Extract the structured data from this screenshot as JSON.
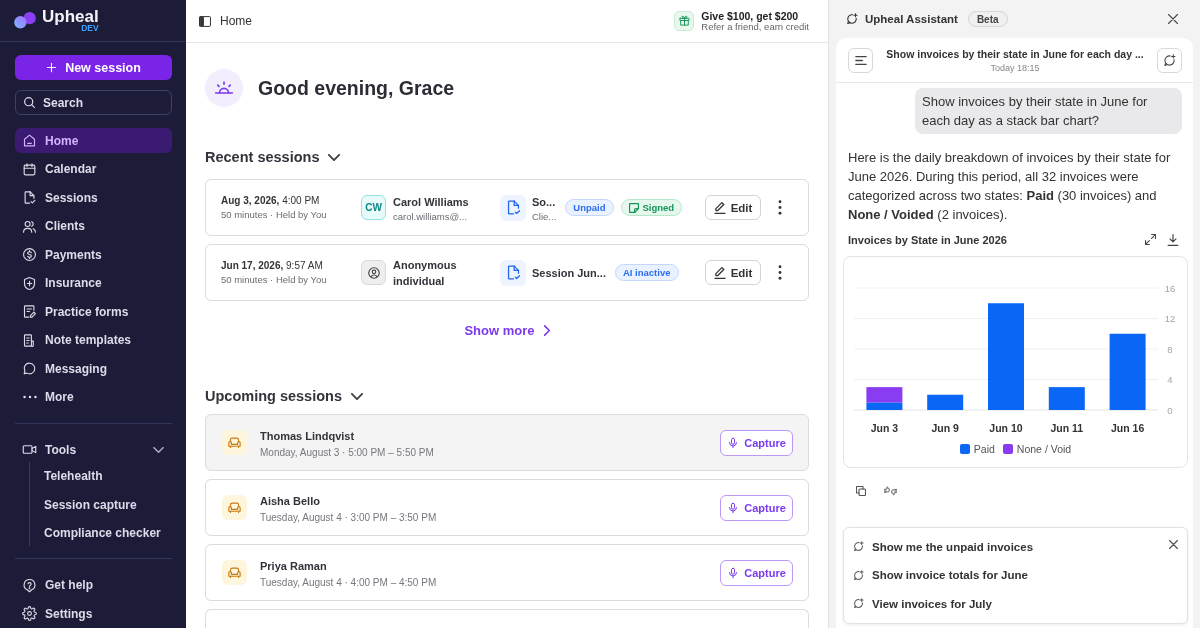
{
  "sidebar": {
    "brand": "Upheal",
    "brand_tag": "DEV",
    "new_session": "New session",
    "search": {
      "placeholder": "Search"
    },
    "nav": [
      {
        "label": "Home",
        "selected": true
      },
      {
        "label": "Calendar",
        "selected": false
      },
      {
        "label": "Sessions",
        "selected": false
      },
      {
        "label": "Clients",
        "selected": false
      },
      {
        "label": "Payments",
        "selected": false
      },
      {
        "label": "Insurance",
        "selected": false
      },
      {
        "label": "Practice forms",
        "selected": false
      },
      {
        "label": "Note templates",
        "selected": false
      },
      {
        "label": "Messaging",
        "selected": false
      },
      {
        "label": "More",
        "selected": false
      }
    ],
    "tools": {
      "label": "Tools",
      "expanded": true,
      "children": [
        {
          "label": "Telehealth"
        },
        {
          "label": "Session capture"
        },
        {
          "label": "Compliance checker"
        }
      ]
    },
    "footer": [
      {
        "label": "Get help"
      },
      {
        "label": "Settings"
      }
    ]
  },
  "header": {
    "breadcrumb": "Home",
    "promo": {
      "title": "Give $100, get $200",
      "subtitle": "Refer a friend, earn credit"
    }
  },
  "greeting": "Good evening, Grace",
  "recent_sessions": {
    "title": "Recent sessions",
    "expanded": true,
    "sessions": [
      {
        "when": "**Aug 3, 2026,** 4:00 PM",
        "details": "50 minutes · Held by You",
        "client": {
          "kind": "initials",
          "initials": "CW",
          "name": "Carol Williams",
          "email": "carol.williams@..."
        },
        "note": {
          "title": "So...",
          "subtitle": "Clie..."
        },
        "badges": [
          {
            "kind": "info",
            "label": "Unpaid"
          },
          {
            "kind": "success",
            "label": "Signed"
          }
        ],
        "edit": "Edit"
      },
      {
        "when": "**Jun 17, 2026,** 9:57 AM",
        "details": "50 minutes · Held by You",
        "client": {
          "kind": "anonymous",
          "name": "Anonymous individual"
        },
        "note": {
          "title": "Session Jun..."
        },
        "badges": [
          {
            "kind": "info",
            "label": "AI inactive"
          }
        ],
        "edit": "Edit"
      }
    ],
    "show_more": "Show more"
  },
  "upcoming_sessions": {
    "title": "Upcoming sessions",
    "expanded": true,
    "sessions": [
      {
        "name": "Thomas Lindqvist",
        "time": "Monday, August 3 · 5:00 PM – 5:50 PM",
        "action": "Capture",
        "hovered": true
      },
      {
        "name": "Aisha Bello",
        "time": "Tuesday, August 4 · 3:00 PM – 3:50 PM",
        "action": "Capture",
        "hovered": false
      },
      {
        "name": "Priya Raman",
        "time": "Tuesday, August 4 · 4:00 PM – 4:50 PM",
        "action": "Capture",
        "hovered": false
      }
    ]
  },
  "assistant": {
    "title": "Upheal Assistant",
    "badge": "Beta",
    "conversation": {
      "title": "Show invoices by their state in June for each day ...",
      "time": "Today 18:15"
    },
    "messages": [
      {
        "kind": "user",
        "text": "Show invoices by their state in June for each day as a stack bar chart?"
      },
      {
        "kind": "assistant",
        "text": "Here is the daily breakdown of invoices by their state for June 2026. During this period, all 32 invoices were categorized across two states: **Paid** (30 invoices) and **None / Voided** (2 invoices)."
      }
    ],
    "chart_data": {
      "type": "bar",
      "title": "Invoices by State in June 2026",
      "categories": [
        "Jun 3",
        "Jun 9",
        "Jun 10",
        "Jun 11",
        "Jun 16"
      ],
      "series": [
        {
          "name": "Paid",
          "color": "#0a66f5",
          "values": [
            1,
            2,
            14,
            3,
            10
          ]
        },
        {
          "name": "None / Void",
          "color": "#8a3cf2",
          "values": [
            2,
            0,
            0,
            0,
            0
          ]
        }
      ],
      "stacked": true,
      "ylim": [
        0,
        16
      ],
      "yticks": [
        0,
        4,
        8,
        12,
        16
      ],
      "grid": true,
      "legend": true
    },
    "suggestions": [
      "Show me the unpaid invoices",
      "Show invoice totals for June",
      "View invoices for July"
    ]
  }
}
